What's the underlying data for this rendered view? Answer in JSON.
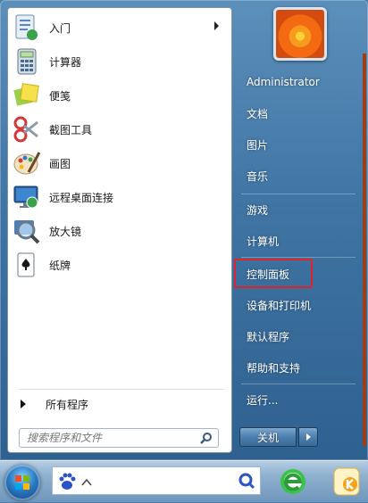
{
  "start_menu": {
    "programs": [
      {
        "label": "入门",
        "icon": "getting-started-icon",
        "has_submenu": true
      },
      {
        "label": "计算器",
        "icon": "calculator-icon",
        "has_submenu": false
      },
      {
        "label": "便笺",
        "icon": "sticky-notes-icon",
        "has_submenu": false
      },
      {
        "label": "截图工具",
        "icon": "snipping-tool-icon",
        "has_submenu": false
      },
      {
        "label": "画图",
        "icon": "paint-icon",
        "has_submenu": false
      },
      {
        "label": "远程桌面连接",
        "icon": "remote-desktop-icon",
        "has_submenu": false
      },
      {
        "label": "放大镜",
        "icon": "magnifier-icon",
        "has_submenu": false
      },
      {
        "label": "纸牌",
        "icon": "solitaire-icon",
        "has_submenu": false
      }
    ],
    "all_programs_label": "所有程序",
    "search_placeholder": "搜索程序和文件",
    "user_name": "Administrator",
    "right_items": [
      "文档",
      "图片",
      "音乐",
      "游戏",
      "计算机",
      "控制面板",
      "设备和打印机",
      "默认程序",
      "帮助和支持",
      "运行..."
    ],
    "highlighted_item": "控制面板",
    "shutdown_label": "关机"
  },
  "colors": {
    "highlight_border": "#e1232a",
    "menu_blue": "#3f74a3",
    "accent_orange": "#9c3e1a"
  }
}
